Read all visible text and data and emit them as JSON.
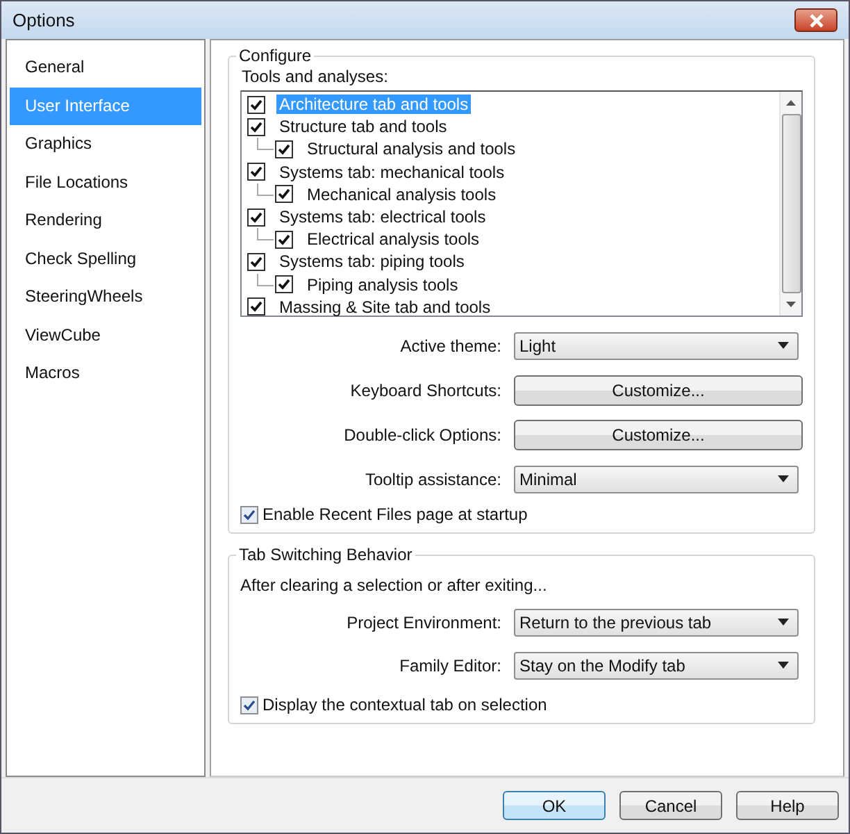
{
  "window": {
    "title": "Options"
  },
  "sidebar": {
    "items": [
      {
        "label": "General",
        "selected": false
      },
      {
        "label": "User Interface",
        "selected": true
      },
      {
        "label": "Graphics",
        "selected": false
      },
      {
        "label": "File Locations",
        "selected": false
      },
      {
        "label": "Rendering",
        "selected": false
      },
      {
        "label": "Check Spelling",
        "selected": false
      },
      {
        "label": "SteeringWheels",
        "selected": false
      },
      {
        "label": "ViewCube",
        "selected": false
      },
      {
        "label": "Macros",
        "selected": false
      }
    ]
  },
  "configure": {
    "title": "Configure",
    "tools_label": "Tools and analyses:",
    "tools": [
      {
        "label": "Architecture tab and tools",
        "checked": true,
        "selected": true
      },
      {
        "label": "Structure tab and tools",
        "checked": true,
        "selected": false,
        "children": [
          {
            "label": "Structural analysis and tools",
            "checked": true,
            "selected": false
          }
        ]
      },
      {
        "label": "Systems tab: mechanical tools",
        "checked": true,
        "selected": false,
        "children": [
          {
            "label": "Mechanical analysis tools",
            "checked": true,
            "selected": false
          }
        ]
      },
      {
        "label": "Systems tab: electrical tools",
        "checked": true,
        "selected": false,
        "children": [
          {
            "label": "Electrical analysis tools",
            "checked": true,
            "selected": false
          }
        ]
      },
      {
        "label": "Systems tab: piping tools",
        "checked": true,
        "selected": false,
        "children": [
          {
            "label": "Piping analysis tools",
            "checked": true,
            "selected": false
          }
        ]
      },
      {
        "label": "Massing & Site tab and tools",
        "checked": true,
        "selected": false
      }
    ],
    "settings": [
      {
        "kind": "dropdown",
        "label": "Active theme:",
        "value": "Light"
      },
      {
        "kind": "button",
        "label": "Keyboard Shortcuts:",
        "value": "Customize..."
      },
      {
        "kind": "button",
        "label": "Double-click Options:",
        "value": "Customize..."
      },
      {
        "kind": "dropdown",
        "label": "Tooltip assistance:",
        "value": "Minimal"
      }
    ],
    "recent_files": {
      "label": "Enable Recent Files page at startup",
      "checked": true
    }
  },
  "tab_switching": {
    "title": "Tab Switching Behavior",
    "intro": "After clearing a selection or after exiting...",
    "settings": [
      {
        "kind": "dropdown",
        "label": "Project Environment:",
        "value": "Return to the previous tab"
      },
      {
        "kind": "dropdown",
        "label": "Family Editor:",
        "value": "Stay on the Modify tab"
      }
    ],
    "contextual": {
      "label": "Display the contextual tab on selection",
      "checked": true
    }
  },
  "buttons": [
    {
      "label": "OK",
      "default": true
    },
    {
      "label": "Cancel",
      "default": false
    },
    {
      "label": "Help",
      "default": false
    }
  ]
}
